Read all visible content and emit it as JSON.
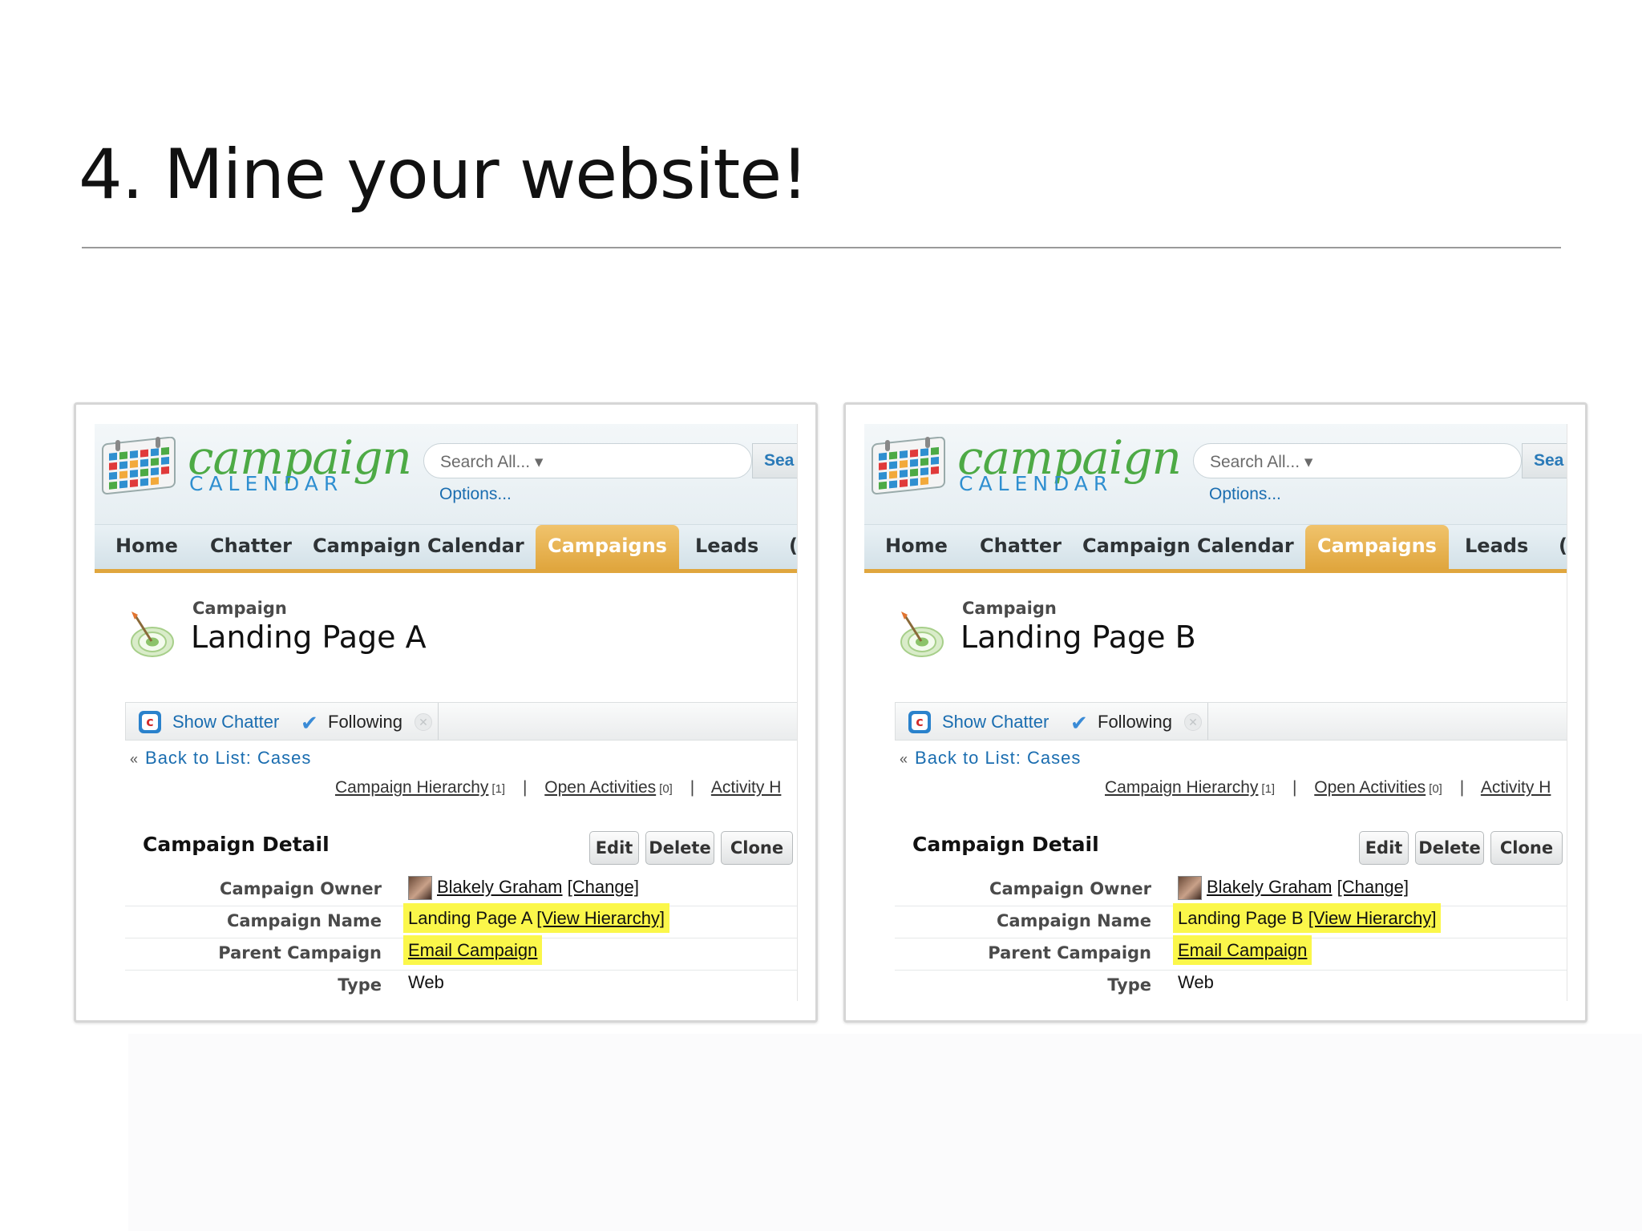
{
  "slide": {
    "title": "4. Mine your website!"
  },
  "app": {
    "logo_word": "campaign",
    "logo_sub": "CALENDAR",
    "search_placeholder": "Search All... ▾",
    "search_button": "Sea",
    "options_link": "Options...",
    "tabs": [
      "Home",
      "Chatter",
      "Campaign Calendar",
      "Campaigns",
      "Leads",
      "("
    ],
    "active_tab": "Campaigns",
    "record_type": "Campaign",
    "show_chatter": "Show Chatter",
    "following": "Following",
    "back_link_raquo": "«",
    "back_link": "Back to List: Cases",
    "related": {
      "hierarchy": "Campaign Hierarchy",
      "hierarchy_count": "[1]",
      "activities": "Open Activities",
      "activities_count": "[0]",
      "history": "Activity H",
      "separator": "|"
    },
    "detail_title": "Campaign Detail",
    "buttons": {
      "edit": "Edit",
      "delete": "Delete",
      "clone": "Clone"
    },
    "labels": {
      "owner": "Campaign Owner",
      "name": "Campaign Name",
      "parent": "Parent Campaign",
      "type": "Type"
    },
    "owner_name": "Blakely Graham",
    "change_link": "[Change]",
    "view_hierarchy": "[View Hierarchy]",
    "parent_value": "Email Campaign",
    "type_value": "Web"
  },
  "panels": [
    {
      "record_name": "Landing Page A"
    },
    {
      "record_name": "Landing Page B"
    }
  ],
  "colors": {
    "tab_active": "#e0a63e",
    "link": "#1a6db0",
    "highlight": "#fbf74a",
    "logo_green": "#4daa45",
    "logo_blue": "#2f8fd0"
  }
}
